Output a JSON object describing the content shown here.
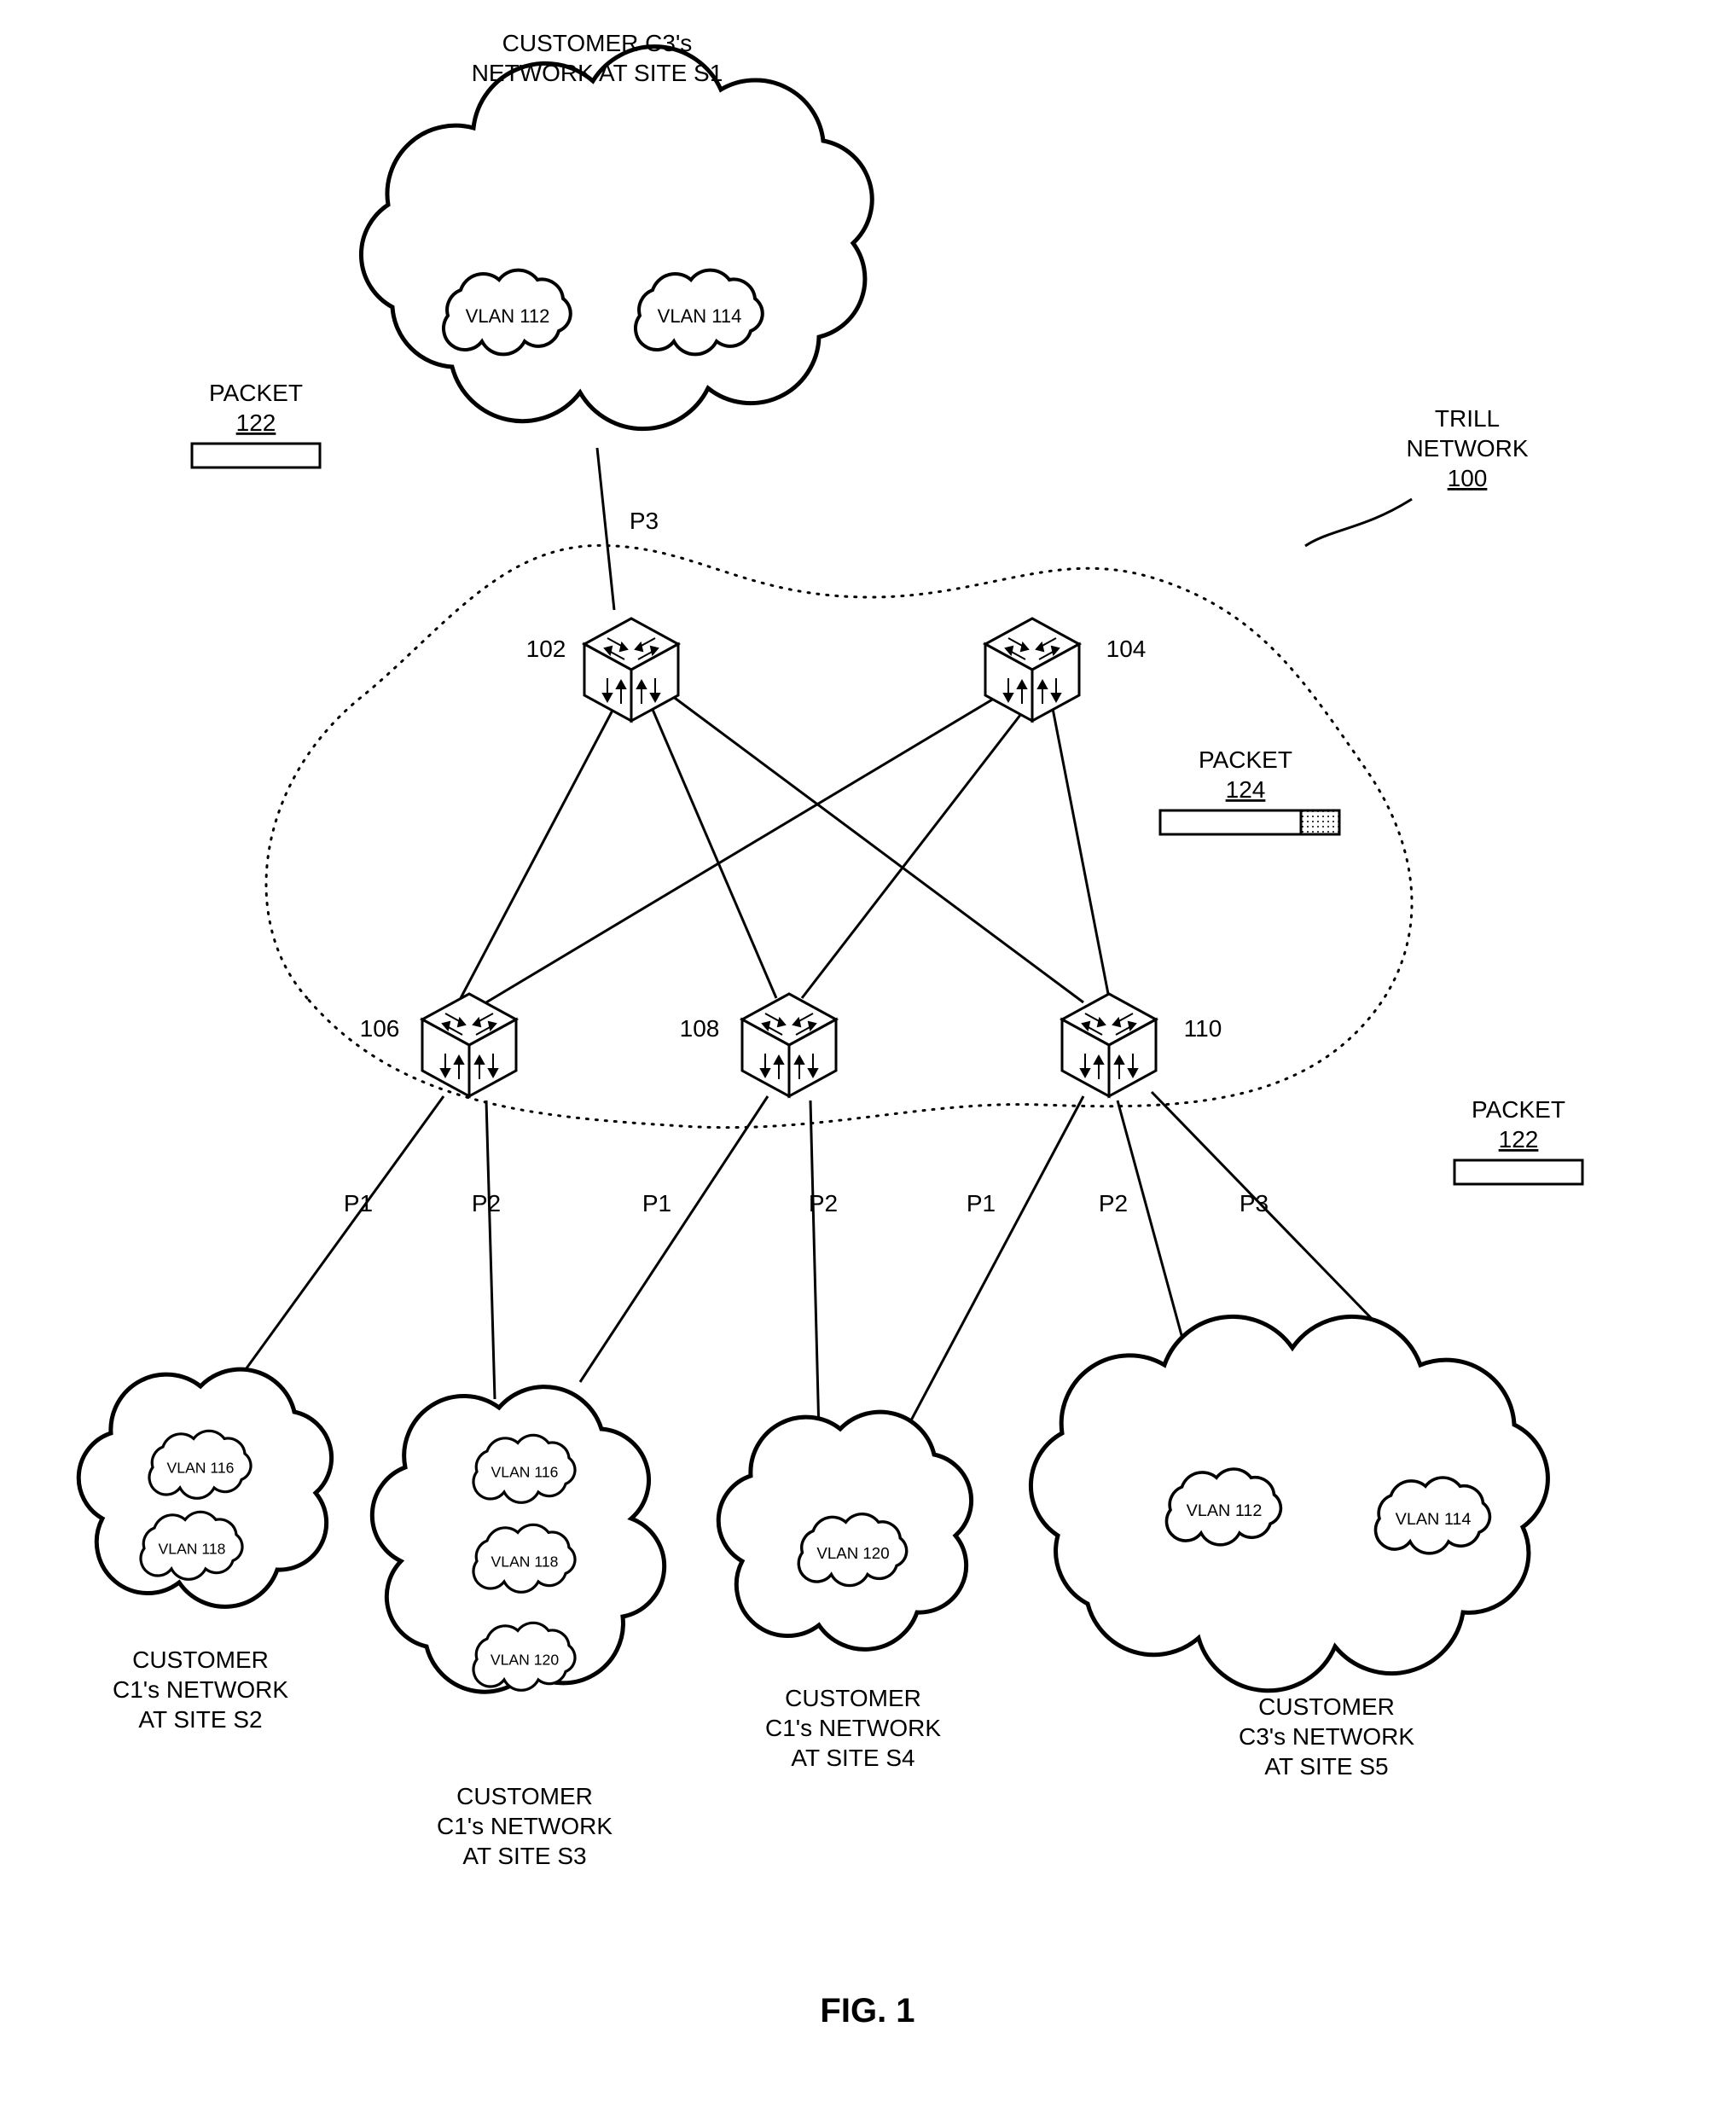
{
  "chart_data": {
    "type": "network-diagram",
    "topology": "TRILL core with 5 RBridges; 5 customer cloud sites attached at edge ports",
    "trill_network": {
      "id": "100",
      "nodes": [
        "102",
        "104",
        "106",
        "108",
        "110"
      ]
    },
    "links_core": [
      [
        "102",
        "106"
      ],
      [
        "102",
        "108"
      ],
      [
        "102",
        "110"
      ],
      [
        "104",
        "106"
      ],
      [
        "104",
        "108"
      ],
      [
        "104",
        "110"
      ]
    ],
    "edge_ports": {
      "102": [
        "P3"
      ],
      "106": [
        "P1",
        "P2"
      ],
      "108": [
        "P1",
        "P2"
      ],
      "110": [
        "P1",
        "P2",
        "P3"
      ]
    },
    "clouds": [
      {
        "customer": "C3",
        "site": "S1",
        "vlans": [
          "VLAN 112",
          "VLAN 114"
        ],
        "attached_to": "102",
        "port": "P3"
      },
      {
        "customer": "C1",
        "site": "S2",
        "vlans": [
          "VLAN 116",
          "VLAN 118"
        ],
        "attached_to": "106",
        "port": "P1"
      },
      {
        "customer": "C1",
        "site": "S3",
        "vlans": [
          "VLAN 116",
          "VLAN 118",
          "VLAN 120"
        ],
        "attached_to": [
          "106/P2",
          "108/P1"
        ]
      },
      {
        "customer": "C1",
        "site": "S4",
        "vlans": [
          "VLAN 120"
        ],
        "attached_to": [
          "108/P2",
          "110/P1"
        ]
      },
      {
        "customer": "C3",
        "site": "S5",
        "vlans": [
          "VLAN 112",
          "VLAN 114"
        ],
        "attached_to": [
          "110/P2",
          "110/P3"
        ]
      }
    ],
    "packets": [
      {
        "id": "122",
        "style": "plain",
        "location": "upper-left, near S1/102"
      },
      {
        "id": "124",
        "style": "with-shaded-tail",
        "location": "inside TRILL cloud, right side"
      },
      {
        "id": "122",
        "style": "plain",
        "location": "right side, near 110/S5"
      }
    ]
  },
  "title": {
    "line1": "CUSTOMER C3's",
    "line2": "NETWORK AT SITE S1"
  },
  "trill": {
    "l1": "TRILL",
    "l2": "NETWORK",
    "l3": "100"
  },
  "nodes": {
    "n102": "102",
    "n104": "104",
    "n106": "106",
    "n108": "108",
    "n110": "110"
  },
  "ports": {
    "p1": "P1",
    "p2": "P2",
    "p3": "P3"
  },
  "packets": {
    "p122_label": "PACKET",
    "p122_num": "122",
    "p124_label": "PACKET",
    "p124_num": "124"
  },
  "vlans": {
    "v112": "VLAN 112",
    "v114": "VLAN 114",
    "v116": "VLAN 116",
    "v118": "VLAN 118",
    "v120": "VLAN 120"
  },
  "cloud_labels": {
    "s2_l1": "CUSTOMER",
    "s2_l2": "C1's NETWORK",
    "s2_l3": "AT SITE S2",
    "s3_l1": "CUSTOMER",
    "s3_l2": "C1's NETWORK",
    "s3_l3": "AT SITE S3",
    "s4_l1": "CUSTOMER",
    "s4_l2": "C1's NETWORK",
    "s4_l3": "AT SITE S4",
    "s5_l1": "CUSTOMER",
    "s5_l2": "C3's NETWORK",
    "s5_l3": "AT SITE S5"
  },
  "figure": "FIG. 1"
}
